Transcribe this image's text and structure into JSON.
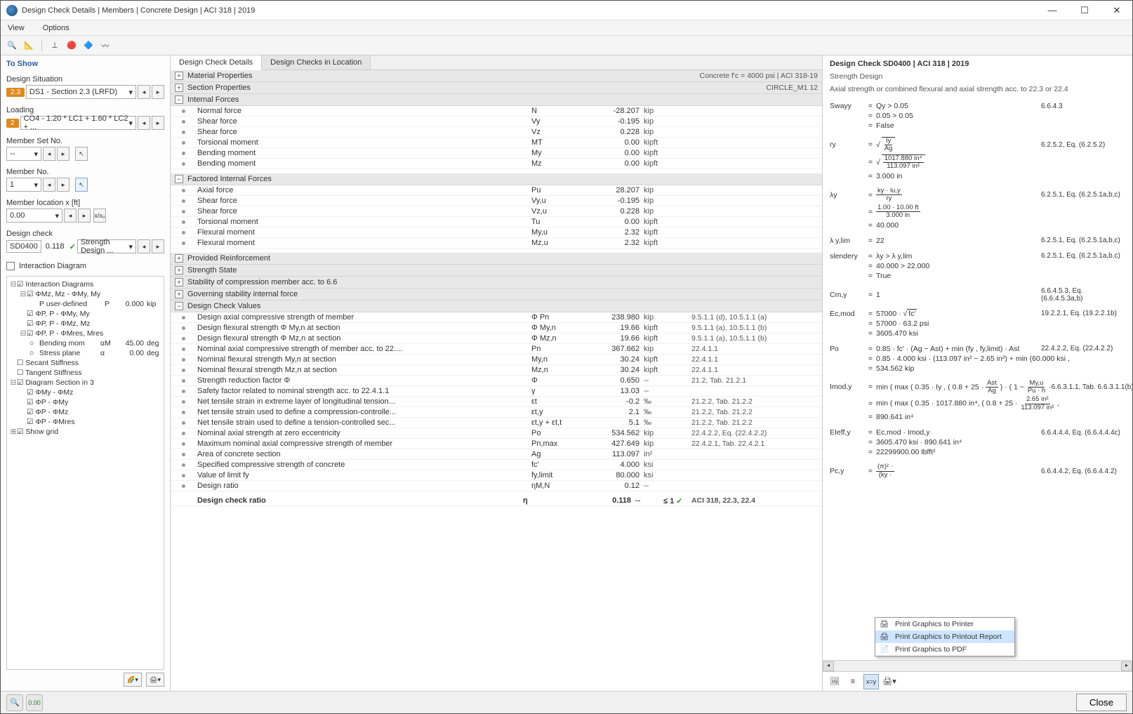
{
  "window": {
    "title": "Design Check Details | Members | Concrete Design | ACI 318 | 2019",
    "minimize": "—",
    "maximize": "☐",
    "close": "✕"
  },
  "menu": {
    "view": "View",
    "options": "Options"
  },
  "left": {
    "toshow": "To Show",
    "design_situation": "Design Situation",
    "ds_badge": "2.3",
    "ds_value": "DS1 - Section 2.3 (LRFD)",
    "loading": "Loading",
    "load_badge": "2",
    "load_value": "CO4 - 1.20 * LC1 + 1.60 * LC2 + ...",
    "member_set_no": "Member Set No.",
    "member_set_val": "--",
    "member_no": "Member No.",
    "member_no_val": "1",
    "member_loc": "Member location x [ft]",
    "member_loc_val": "0.00",
    "xx0": "x/x₀",
    "design_check": "Design check",
    "dc_code": "SD0400",
    "dc_ratio": "0.118",
    "dc_name": "Strength Design ...",
    "interaction_diagram": "Interaction Diagram",
    "tree": {
      "n0": "Interaction Diagrams",
      "n1": "ΦMz, Mz - ΦMy, My",
      "n2_a": "P user-defined",
      "n2_b": "P",
      "n2_c": "0.000",
      "n2_d": "kip",
      "n3": "ΦP, P - ΦMy, My",
      "n4": "ΦP, P - ΦMz, Mz",
      "n5": "ΦP, P - ΦMres, Mres",
      "n6_a": "Bending mom",
      "n6_b": "αM",
      "n6_c": "45.00",
      "n6_d": "deg",
      "n7_a": "Stress plane",
      "n7_b": "α",
      "n7_c": "0.00",
      "n7_d": "deg",
      "n8": "Secant Stiffness",
      "n9": "Tangent Stiffness",
      "n10": "Diagram Section in 3",
      "n11": "ΦMy - ΦMz",
      "n12": "ΦP - ΦMy",
      "n13": "ΦP - ΦMz",
      "n14": "ΦP - ΦMres",
      "n15": "Show grid"
    }
  },
  "mid": {
    "tab1": "Design Check Details",
    "tab2": "Design Checks in Location",
    "groups": {
      "mat_props": "Material Properties",
      "mat_props_right": "Concrete f'c = 4000 psi | ACI 318-19",
      "sec_props": "Section Properties",
      "sec_props_right": "CIRCLE_M1 12",
      "int_forces": "Internal Forces",
      "fact_int": "Factored Internal Forces",
      "prov_reinf": "Provided Reinforcement",
      "strength_state": "Strength State",
      "stability": "Stability of compression member acc. to 6.6",
      "gov_stab": "Governing stability internal force",
      "dcv": "Design Check Values"
    },
    "int_forces_rows": [
      {
        "d": "Normal force",
        "s": "N",
        "v": "-28.207",
        "u": "kip"
      },
      {
        "d": "Shear force",
        "s": "Vy",
        "v": "-0.195",
        "u": "kip"
      },
      {
        "d": "Shear force",
        "s": "Vz",
        "v": "0.228",
        "u": "kip"
      },
      {
        "d": "Torsional moment",
        "s": "MT",
        "v": "0.00",
        "u": "kipft"
      },
      {
        "d": "Bending moment",
        "s": "My",
        "v": "0.00",
        "u": "kipft"
      },
      {
        "d": "Bending moment",
        "s": "Mz",
        "v": "0.00",
        "u": "kipft"
      }
    ],
    "fact_rows": [
      {
        "d": "Axial force",
        "s": "Pu",
        "v": "28.207",
        "u": "kip"
      },
      {
        "d": "Shear force",
        "s": "Vy,u",
        "v": "-0.195",
        "u": "kip"
      },
      {
        "d": "Shear force",
        "s": "Vz,u",
        "v": "0.228",
        "u": "kip"
      },
      {
        "d": "Torsional moment",
        "s": "Tu",
        "v": "0.00",
        "u": "kipft"
      },
      {
        "d": "Flexural moment",
        "s": "My,u",
        "v": "2.32",
        "u": "kipft"
      },
      {
        "d": "Flexural moment",
        "s": "Mz,u",
        "v": "2.32",
        "u": "kipft"
      }
    ],
    "dcv_rows": [
      {
        "d": "Design axial compressive strength of member",
        "s": "Φ Pn",
        "v": "238.980",
        "u": "kip",
        "r": "9.5.1.1 (d), 10.5.1.1 (a)"
      },
      {
        "d": "Design flexural strength Φ My,n at section",
        "s": "Φ My,n",
        "v": "19.66",
        "u": "kipft",
        "r": "9.5.1.1 (a), 10.5.1.1 (b)"
      },
      {
        "d": "Design flexural strength Φ Mz,n at section",
        "s": "Φ Mz,n",
        "v": "19.66",
        "u": "kipft",
        "r": "9.5.1.1 (a), 10.5.1.1 (b)"
      },
      {
        "d": "Nominal axial compressive strength of member acc. to 22....",
        "s": "Pn",
        "v": "367.662",
        "u": "kip",
        "r": "22.4.1.1"
      },
      {
        "d": "Nominal flexural strength My,n at section",
        "s": "My,n",
        "v": "30.24",
        "u": "kipft",
        "r": "22.4.1.1"
      },
      {
        "d": "Nominal flexural strength Mz,n at section",
        "s": "Mz,n",
        "v": "30.24",
        "u": "kipft",
        "r": "22.4.1.1"
      },
      {
        "d": "Strength reduction factor Φ",
        "s": "Φ",
        "v": "0.650",
        "u": "--",
        "r": "21.2, Tab. 21.2.1"
      },
      {
        "d": "Safety factor related to nominal strength acc. to 22.4.1.1",
        "s": "γ",
        "v": "13.03",
        "u": "--",
        "r": ""
      },
      {
        "d": "Net tensile strain in extreme layer of longitudinal tension...",
        "s": "εt",
        "v": "-0.2",
        "u": "‰",
        "r": "21.2.2, Tab. 21.2.2"
      },
      {
        "d": "Net tensile strain used to define a compression-controlle...",
        "s": "εt,y",
        "v": "2.1",
        "u": "‰",
        "r": "21.2.2, Tab. 21.2.2"
      },
      {
        "d": "Net tensile strain used to define a tension-controlled sec...",
        "s": "εt,y + εt,t",
        "v": "5.1",
        "u": "‰",
        "r": "21.2.2, Tab. 21.2.2"
      },
      {
        "d": "Nominal axial strength at zero eccentricity",
        "s": "Po",
        "v": "534.562",
        "u": "kip",
        "r": "22.4.2.2, Eq. (22.4.2.2)"
      },
      {
        "d": "Maximum nominal axial compressive strength of member",
        "s": "Pn,max",
        "v": "427.649",
        "u": "kip",
        "r": "22.4.2.1, Tab. 22.4.2.1"
      },
      {
        "d": "Area of concrete section",
        "s": "Ag",
        "v": "113.097",
        "u": "in²",
        "r": ""
      },
      {
        "d": "Specified compressive strength of concrete",
        "s": "fc'",
        "v": "4.000",
        "u": "ksi",
        "r": ""
      },
      {
        "d": "Value of limit fy",
        "s": "fy,limit",
        "v": "80.000",
        "u": "ksi",
        "r": ""
      },
      {
        "d": "Design ratio",
        "s": "ηM,N",
        "v": "0.12",
        "u": "--",
        "r": ""
      }
    ],
    "final_row": {
      "d": "Design check ratio",
      "s": "η",
      "v": "0.118",
      "u": "--",
      "lim": "≤ 1",
      "r": "ACI 318, 22.3, 22.4"
    }
  },
  "right": {
    "header": "Design Check SD0400 | ACI 318 | 2019",
    "sub1": "Strength Design",
    "sub2": "Axial strength or combined flexural and axial strength acc. to 22.3 or 22.4",
    "context": {
      "printer": "Print Graphics to Printer",
      "report": "Print Graphics to Printout Report",
      "pdf": "Print Graphics to PDF"
    },
    "eqs": [
      {
        "var": "Swayy",
        "eq": "=",
        "expr": "Qy  >  0.05",
        "ref": "6.6.4.3"
      },
      {
        "var": "",
        "eq": "=",
        "expr": "0.05  >  0.05",
        "ref": ""
      },
      {
        "var": "",
        "eq": "=",
        "expr": "False",
        "ref": ""
      },
      {
        "spacer": true
      },
      {
        "var": "ry",
        "eq": "=",
        "expr": "<span class='sqrt-sym'>√</span><span class='sqrt-sign'><span class='frac'><span class='num'>Iy</span><span class='den'>Ag</span></span></span>",
        "ref": "6.2.5.2, Eq. (6.2.5.2)"
      },
      {
        "var": "",
        "eq": "=",
        "expr": "<span class='sqrt-sym'>√</span><span class='sqrt-sign'><span class='frac'><span class='num'>1017.880 in⁴</span><span class='den'>113.097 in²</span></span></span>",
        "ref": ""
      },
      {
        "var": "",
        "eq": "=",
        "expr": "3.000 in",
        "ref": ""
      },
      {
        "spacer": true
      },
      {
        "var": "λy",
        "eq": "=",
        "expr": "<span class='frac'><span class='num'>ky · lu,y</span><span class='den'>ry</span></span>",
        "ref": "6.2.5.1, Eq. (6.2.5.1a,b,c)"
      },
      {
        "var": "",
        "eq": "=",
        "expr": "<span class='frac'><span class='num'>1.00  ·  10.00 ft</span><span class='den'>3.000 in</span></span>",
        "ref": ""
      },
      {
        "var": "",
        "eq": "=",
        "expr": "40.000",
        "ref": ""
      },
      {
        "spacer": true
      },
      {
        "var": "λ y,lim",
        "eq": "=",
        "expr": "22",
        "ref": "6.2.5.1, Eq. (6.2.5.1a,b,c)"
      },
      {
        "spacer": true
      },
      {
        "var": "slendery",
        "eq": "=",
        "expr": "λy  >  λ y,lim",
        "ref": "6.2.5.1, Eq. (6.2.5.1a,b,c)"
      },
      {
        "var": "",
        "eq": "=",
        "expr": "40.000  >  22.000",
        "ref": ""
      },
      {
        "var": "",
        "eq": "=",
        "expr": "True",
        "ref": ""
      },
      {
        "spacer": true
      },
      {
        "var": "Cm,y",
        "eq": "=",
        "expr": "1",
        "ref": "6.6.4.5.3, Eq. (6.6.4.5.3a,b)"
      },
      {
        "spacer": true
      },
      {
        "var": "Ec,mod",
        "eq": "=",
        "expr": "57000  ·  √<span style='border-top:1px solid #333;padding:0 2px'>fc'</span>",
        "ref": "19.2.2.1, Eq. (19.2.2.1b)"
      },
      {
        "var": "",
        "eq": "=",
        "expr": "57000  ·  63.2 psi",
        "ref": ""
      },
      {
        "var": "",
        "eq": "=",
        "expr": "3605.470 ksi",
        "ref": ""
      },
      {
        "spacer": true
      },
      {
        "var": "Po",
        "eq": "=",
        "expr": "0.85 · fc' · (Ag − Ast) + min (fy , fy,limit) · Ast",
        "ref": "22.4.2.2, Eq. (22.4.2.2)"
      },
      {
        "var": "",
        "eq": "=",
        "expr": "0.85 · 4.000 ksi · (113.097 in² − 2.65 in²) + min (60.000 ksi ,",
        "ref": ""
      },
      {
        "var": "",
        "eq": "=",
        "expr": "534.562 kip",
        "ref": ""
      },
      {
        "spacer": true
      },
      {
        "var": "Imod,y",
        "eq": "=",
        "expr": "min ( max ( 0.35 · Iy , ( 0.8 + 25 · <span class='frac'><span class='num'>Ast</span><span class='den'>Ag</span></span> ) · ( 1 − <span class='frac'><span class='num'>My,u</span><span class='den'>Pu · h</span></span> ·",
        "ref": "6.6.3.1.1, Tab. 6.6.3.1.1(b)"
      },
      {
        "var": "",
        "eq": "=",
        "expr": "min ( max ( 0.35 · 1017.880 in⁴, ( 0.8 + 25 · <span class='frac'><span class='num'>2.65 in²</span><span class='den'>113.097 in²</span></span> ,",
        "ref": ""
      },
      {
        "var": "",
        "eq": "=",
        "expr": "890.641 in⁴",
        "ref": ""
      },
      {
        "spacer": true
      },
      {
        "var": "EIeff,y",
        "eq": "=",
        "expr": "Ec,mod  ·  Imod,y",
        "ref": "6.6.4.4.4, Eq. (6.6.4.4.4c)"
      },
      {
        "var": "",
        "eq": "=",
        "expr": "3605.470 ksi  ·  890.641 in⁴",
        "ref": ""
      },
      {
        "var": "",
        "eq": "=",
        "expr": "22299900.00 lbfft²",
        "ref": ""
      },
      {
        "spacer": true
      },
      {
        "var": "Pc,y",
        "eq": "=",
        "expr": "<span class='frac'><span class='num'>(π)² ·</span><span class='den'>(ky ·</span></span>",
        "ref": "6.6.4.4.2, Eq. (6.6.4.4.2)"
      }
    ]
  },
  "footer": {
    "close": "Close"
  }
}
